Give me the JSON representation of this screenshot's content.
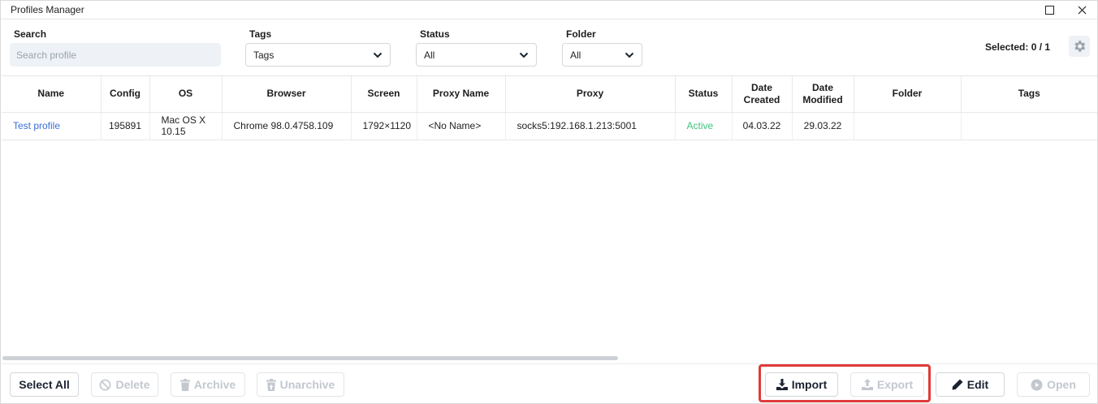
{
  "window": {
    "title": "Profiles Manager"
  },
  "filters": {
    "search": {
      "label": "Search",
      "placeholder": "Search profile"
    },
    "tags": {
      "label": "Tags",
      "value": "Tags"
    },
    "status": {
      "label": "Status",
      "value": "All"
    },
    "folder": {
      "label": "Folder",
      "value": "All"
    },
    "selected_count": "Selected: 0 / 1"
  },
  "table": {
    "columns": [
      "Name",
      "Config",
      "OS",
      "Browser",
      "Screen",
      "Proxy Name",
      "Proxy",
      "Status",
      "Date Created",
      "Date Modified",
      "Folder",
      "Tags"
    ],
    "rows": [
      {
        "name": "Test profile",
        "config": "195891",
        "os": "Mac OS X 10.15",
        "browser": "Chrome 98.0.4758.109",
        "screen": "1792×1120",
        "proxy_name": "<No Name>",
        "proxy": "socks5:192.168.1.213:5001",
        "status": "Active",
        "date_created": "04.03.22",
        "date_modified": "29.03.22",
        "folder": "",
        "tags": ""
      }
    ]
  },
  "footer": {
    "select_all": "Select All",
    "delete": "Delete",
    "archive": "Archive",
    "unarchive": "Unarchive",
    "import": "Import",
    "export": "Export",
    "edit": "Edit",
    "open": "Open"
  },
  "colors": {
    "link": "#3a6fd8",
    "active": "#3cc47c",
    "highlight": "#e03a3a",
    "disabled": "#c3c8cf"
  }
}
